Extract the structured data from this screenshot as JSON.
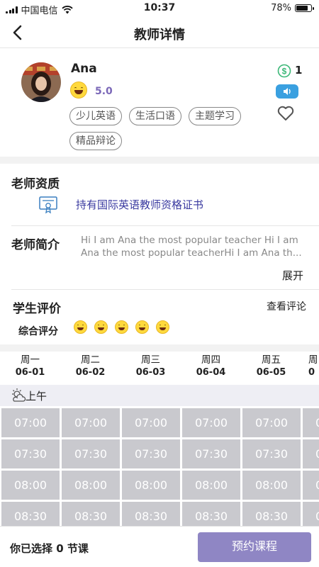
{
  "status_bar": {
    "carrier": "中国电信",
    "time": "10:37",
    "battery": "78%",
    "battery_level": 0.78
  },
  "nav": {
    "title": "教师详情"
  },
  "teacher": {
    "name": "Ana",
    "rating": "5.0",
    "coins": "1",
    "tags": [
      "少儿英语",
      "生活口语",
      "主题学习",
      "精品辩论"
    ]
  },
  "qualification": {
    "title": "老师资质",
    "cert": "持有国际英语教师资格证书"
  },
  "intro": {
    "title": "老师简介",
    "text": "Hi I am Ana the most popular teacher Hi I am Ana the most popular teacherHi I am Ana th...",
    "expand": "展开"
  },
  "reviews": {
    "title": "学生评价",
    "view": "查看评论",
    "overall": "综合评分",
    "stars": 5
  },
  "schedule": {
    "days": [
      {
        "name": "周一",
        "date": "06-01"
      },
      {
        "name": "周二",
        "date": "06-02"
      },
      {
        "name": "周三",
        "date": "06-03"
      },
      {
        "name": "周四",
        "date": "06-04"
      },
      {
        "name": "周五",
        "date": "06-05"
      },
      {
        "name": "周",
        "date": "0"
      }
    ],
    "period": "上午",
    "times": [
      "07:00",
      "07:30",
      "08:00",
      "08:30"
    ]
  },
  "footer": {
    "selected": "你已选择 0 节课",
    "book": "预约课程"
  },
  "colors": {
    "accent": "#8f86c4",
    "score": "#7b68b8",
    "slot": "#c9c9ce",
    "audio": "#3aa0e0"
  }
}
